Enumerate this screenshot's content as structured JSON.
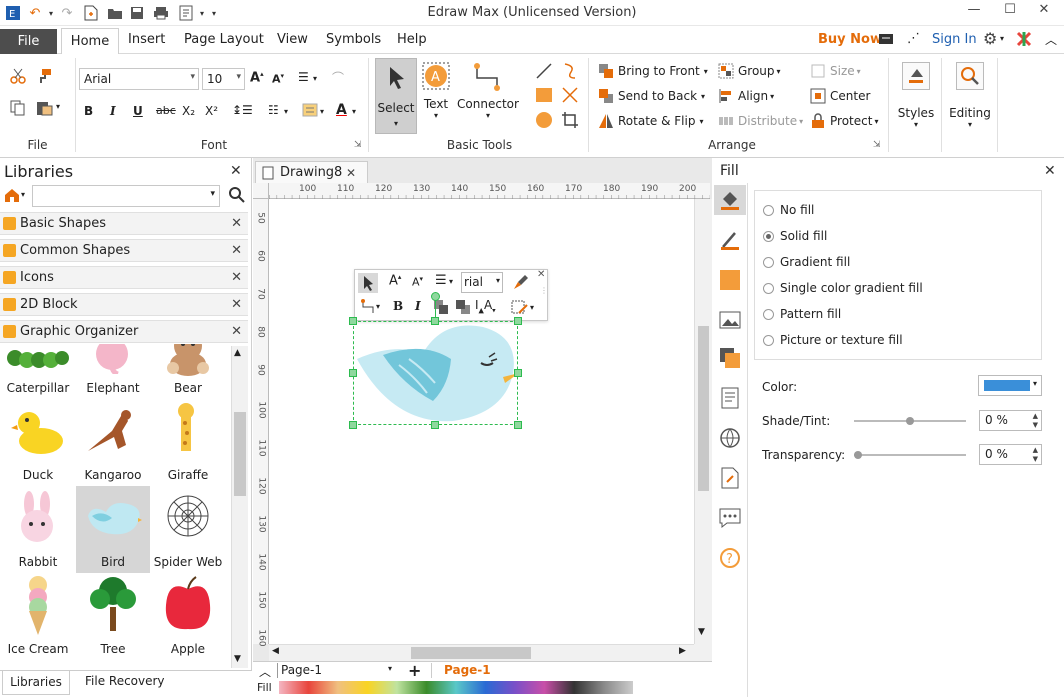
{
  "app": {
    "title": "Edraw Max (Unlicensed Version)",
    "brand_color": "#e46c0a",
    "file_tab_bg": "#4d4d4d"
  },
  "menu": {
    "file": "File",
    "tabs": [
      "Home",
      "Insert",
      "Page Layout",
      "View",
      "Symbols",
      "Help"
    ],
    "buy_now": "Buy Now",
    "sign_in": "Sign In"
  },
  "ribbon": {
    "file_group": {
      "label": "File"
    },
    "font_group": {
      "label": "Font",
      "font_name": "Arial",
      "font_size": "10",
      "bold": "B",
      "italic": "I",
      "underline": "U",
      "strike": "abc",
      "subscript": "X₂",
      "superscript": "X²"
    },
    "basic_tools": {
      "label": "Basic Tools",
      "select": "Select",
      "text": "Text",
      "connector": "Connector"
    },
    "arrange": {
      "label": "Arrange",
      "bring_to_front": "Bring to Front",
      "send_to_back": "Send to Back",
      "rotate_flip": "Rotate & Flip",
      "group": "Group",
      "align": "Align",
      "distribute": "Distribute",
      "size": "Size",
      "center": "Center",
      "protect": "Protect"
    },
    "styles": "Styles",
    "editing": "Editing"
  },
  "libraries": {
    "title": "Libraries",
    "categories": [
      "Basic Shapes",
      "Common Shapes",
      "Icons",
      "2D Block",
      "Graphic Organizer"
    ],
    "shapes": [
      {
        "label": "Caterpillar"
      },
      {
        "label": "Elephant"
      },
      {
        "label": "Bear"
      },
      {
        "label": "Duck"
      },
      {
        "label": "Kangaroo"
      },
      {
        "label": "Giraffe"
      },
      {
        "label": "Rabbit"
      },
      {
        "label": "Bird"
      },
      {
        "label": "Spider Web"
      },
      {
        "label": "Ice Cream"
      },
      {
        "label": "Tree"
      },
      {
        "label": "Apple"
      }
    ],
    "bottom_tabs": [
      "Libraries",
      "File Recovery"
    ]
  },
  "canvas": {
    "doc_tab": "Drawing8",
    "ruler_h": [
      "100",
      "110",
      "120",
      "130",
      "140",
      "150",
      "160",
      "170",
      "180",
      "190",
      "200"
    ],
    "ruler_v": [
      "50",
      "60",
      "70",
      "80",
      "90",
      "100",
      "110",
      "120",
      "130",
      "140",
      "150",
      "160"
    ],
    "mini_toolbar_font": "rial",
    "page_selector": "Page-1",
    "active_page": "Page-1",
    "fill_label": "Fill"
  },
  "fill_panel": {
    "title": "Fill",
    "options": [
      "No fill",
      "Solid fill",
      "Gradient fill",
      "Single color gradient fill",
      "Pattern fill",
      "Picture or texture fill"
    ],
    "selected_index": 1,
    "color_label": "Color:",
    "color_value": "#3a8fd9",
    "shade_label": "Shade/Tint:",
    "shade_value": "0 %",
    "shade_level": 0.5,
    "transparency_label": "Transparency:",
    "transparency_value": "0 %",
    "transparency_level": 0.0
  }
}
